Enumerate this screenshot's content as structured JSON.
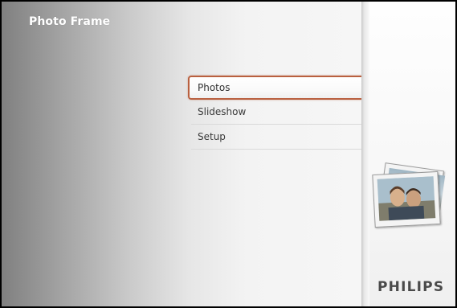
{
  "app": {
    "title": "Photo Frame"
  },
  "menu": {
    "items": [
      {
        "label": "Photos",
        "selected": true
      },
      {
        "label": "Slideshow",
        "selected": false
      },
      {
        "label": "Setup",
        "selected": false
      }
    ]
  },
  "branding": {
    "logo_text": "PHILIPS"
  },
  "colors": {
    "title_text": "#ffffff",
    "selection_border": "#b9603f",
    "menu_text": "#3a3a3a",
    "brand_text": "#4a4a4a",
    "frame_border": "#000000"
  },
  "icons": {
    "photo_preview": "photo-stack-icon"
  }
}
